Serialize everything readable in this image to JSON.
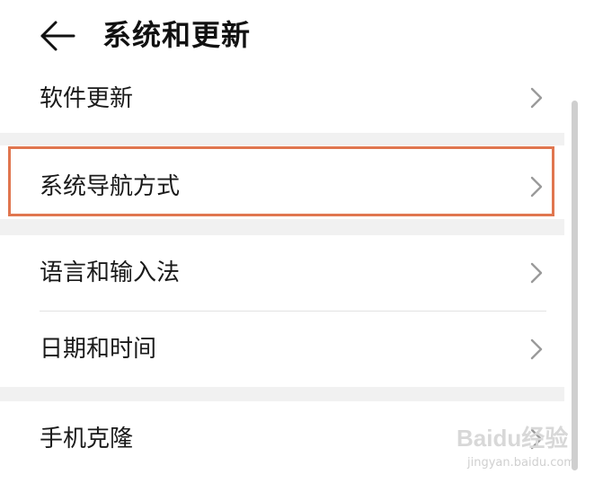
{
  "header": {
    "back_icon": "arrow-left-icon",
    "title": "系统和更新"
  },
  "items": [
    {
      "label": "软件更新",
      "icon": "chevron-right-icon"
    },
    {
      "label": "系统导航方式",
      "icon": "chevron-right-icon",
      "highlighted": true
    },
    {
      "label": "语言和输入法",
      "icon": "chevron-right-icon"
    },
    {
      "label": "日期和时间",
      "icon": "chevron-right-icon"
    },
    {
      "label": "手机克隆",
      "icon": "chevron-right-icon"
    }
  ],
  "highlight_color": "#e0764f",
  "watermark": {
    "brand": "Baidu经验",
    "url": "jingyan.baidu.com"
  }
}
